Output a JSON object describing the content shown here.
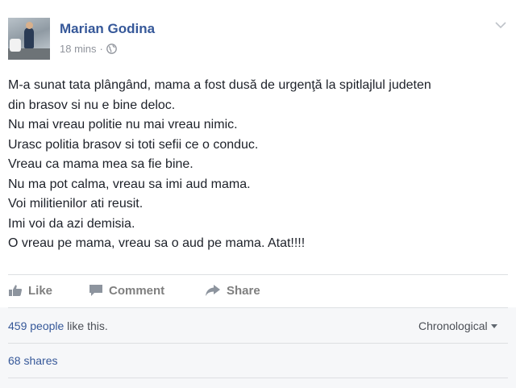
{
  "post": {
    "author": "Marian Godina",
    "time": "18 mins",
    "separator": "·",
    "privacy_icon": "globe-icon",
    "menu_icon": "chevron-down-icon",
    "lines": [
      "M-a sunat tata plângând, mama a fost dusă de urgenţă la spitlajlul judeten",
      "din brasov si nu e bine deloc.",
      "Nu mai vreau politie nu mai vreau nimic.",
      "Urasc politia brasov si toti sefii ce o conduc.",
      "Vreau ca mama mea sa fie bine.",
      "Nu ma pot calma, vreau sa imi aud mama.",
      "Voi militienilor ati reusit.",
      "Imi voi da azi demisia.",
      "O vreau pe mama, vreau sa o aud pe mama. Atat!!!!"
    ]
  },
  "actions": {
    "like": "Like",
    "comment": "Comment",
    "share": "Share"
  },
  "stats": {
    "likes_link": "459 people",
    "likes_suffix": " like this.",
    "order": "Chronological",
    "shares": "68 shares"
  },
  "colors": {
    "author": "#365899",
    "text": "#1d2129",
    "muted": "#90949c",
    "action": "#7f7f7f"
  }
}
